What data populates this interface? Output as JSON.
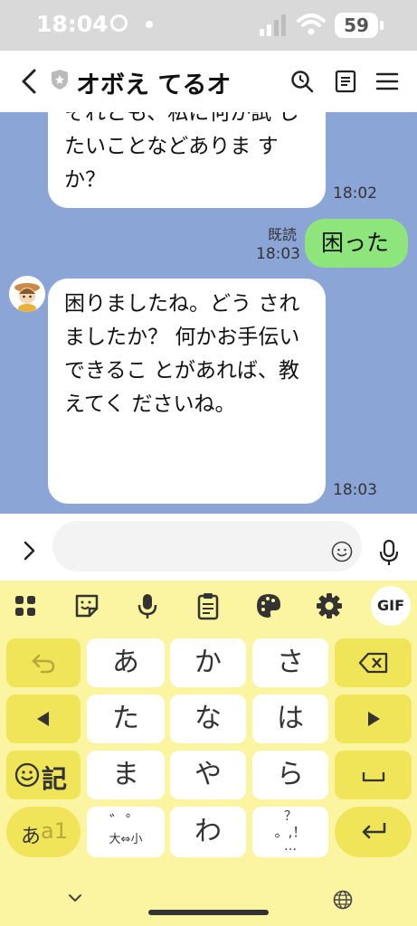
{
  "status": {
    "time": "18:04",
    "battery": "59"
  },
  "header": {
    "title": "オボえ てるオ"
  },
  "chat": {
    "messages": [
      {
        "from": "bot",
        "lines": [
          "それとも、私に何か試",
          "したいことなどありま",
          "すか？"
        ],
        "time": "18:02"
      },
      {
        "from": "me",
        "lines": [
          "困った"
        ],
        "read": "既読",
        "time": "18:03"
      },
      {
        "from": "bot",
        "lines": [
          "困りましたね。どう",
          "されましたか？",
          "",
          "何かお手伝いできるこ",
          "とがあれば、教えてく",
          "ださいね。"
        ],
        "time": "18:03"
      }
    ]
  },
  "input": {
    "placeholder": ""
  },
  "keyboard": {
    "gif_label": "GIF",
    "row1": [
      "あ",
      "か",
      "さ"
    ],
    "row2": [
      "た",
      "な",
      "は"
    ],
    "row3": [
      "ま",
      "や",
      "ら"
    ],
    "row4": [
      "わ"
    ],
    "kigou_label": "記",
    "mode_label_a": "あ",
    "mode_label_b": "a1",
    "dakuten_top": "゛゜",
    "dakuten_bottom": "大⇔小",
    "punct_top": "？",
    "punct_mid": "。,！",
    "punct_bottom": "…"
  },
  "colors": {
    "chat_bg": "#8ba6d6",
    "user_bubble": "#8ee57c",
    "keyboard_bg": "#fbf4a0",
    "fn_key": "#f0e458"
  }
}
